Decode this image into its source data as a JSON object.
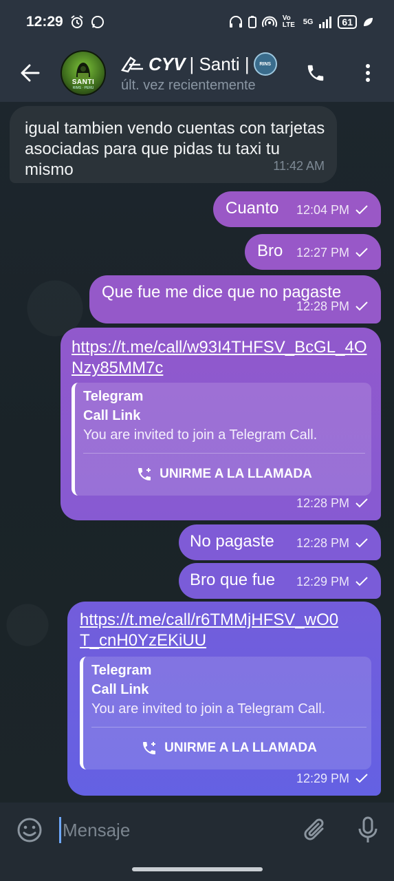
{
  "status_bar": {
    "time": "12:29",
    "lte_label": "Vo LTE",
    "network": "5G",
    "battery": "61"
  },
  "header": {
    "avatar_label": "SANTI",
    "avatar_sublabel": "RIMS · PERU",
    "title_brand": "CYV",
    "title_name": "| Santi |",
    "badge_label": "RINS",
    "subtitle": "últ. vez recientemente"
  },
  "messages": [
    {
      "dir": "in",
      "text": "igual tambien vendo cuentas con tarjetas asociadas para que pidas tu taxi tu mismo",
      "time": "11:42 AM"
    },
    {
      "dir": "out",
      "text": "Cuanto",
      "time": "12:04 PM"
    },
    {
      "dir": "out",
      "text": "Bro",
      "time": "12:27 PM"
    },
    {
      "dir": "out",
      "text": "Que fue me dice que no pagaste",
      "time": "12:28 PM"
    },
    {
      "dir": "out",
      "link": "https://t.me/call/w93I4THFSV_BcGL_4ONzy85MM7c",
      "preview": {
        "site": "Telegram",
        "title": "Call Link",
        "desc": "You are invited to join a Telegram Call.",
        "button": "UNIRME A LA LLAMADA"
      },
      "time": "12:28 PM"
    },
    {
      "dir": "out",
      "text": "No pagaste",
      "time": "12:28 PM"
    },
    {
      "dir": "out",
      "text": "Bro que fue",
      "time": "12:29 PM"
    },
    {
      "dir": "out",
      "link": "https://t.me/call/r6TMMjHFSV_wO0T_cnH0YzEKiUU",
      "preview": {
        "site": "Telegram",
        "title": "Call Link",
        "desc": "You are invited to join a Telegram Call.",
        "button": "UNIRME A LA LLAMADA"
      },
      "time": "12:29 PM"
    }
  ],
  "input": {
    "placeholder": "Mensaje"
  },
  "colors": {
    "bubble_out_top": "#9d5bc6",
    "bubble_out_bottom": "#6a5fe0",
    "bubble_in": "#2b3339",
    "header_bg": "#2b3440"
  }
}
